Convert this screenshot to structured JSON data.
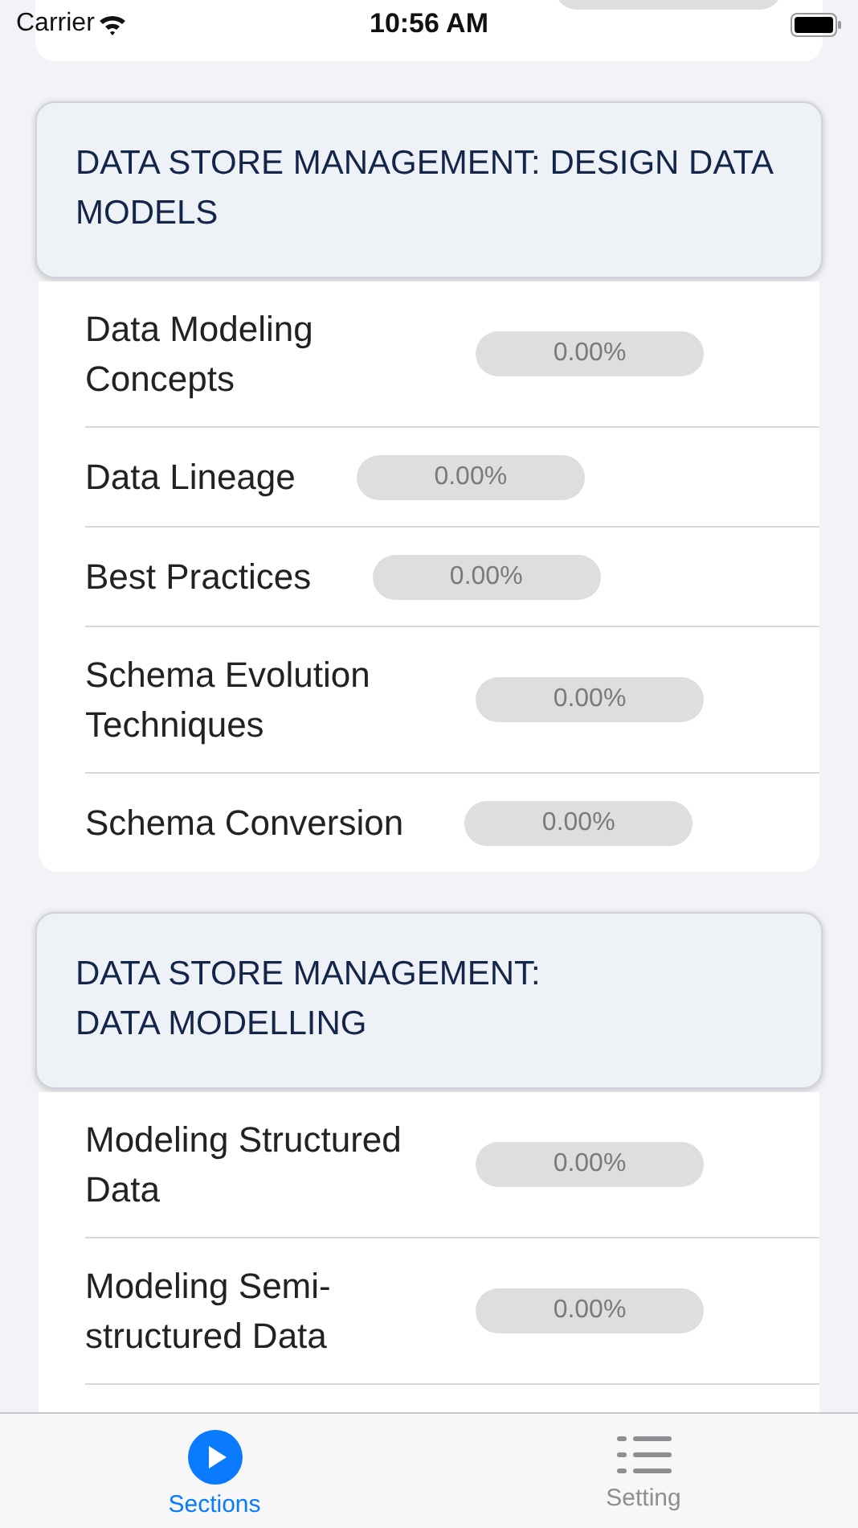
{
  "status_bar": {
    "carrier": "Carrier",
    "time": "10:56 AM"
  },
  "sections": [
    {
      "title": "DATA STORE MANAGEMENT: DESIGN DATA MODELS",
      "topics": [
        {
          "name": "Data Modeling Concepts",
          "progress": "0.00%"
        },
        {
          "name": "Data Lineage",
          "progress": "0.00%"
        },
        {
          "name": "Best Practices",
          "progress": "0.00%"
        },
        {
          "name": "Schema Evolution Techniques",
          "progress": "0.00%"
        },
        {
          "name": "Schema Conversion",
          "progress": "0.00%"
        }
      ]
    },
    {
      "title": "DATA STORE MANAGEMENT:\nDATA MODELLING",
      "topics": [
        {
          "name": "Modeling Structured Data",
          "progress": "0.00%"
        },
        {
          "name": "Modeling Semi-structured Data",
          "progress": "0.00%"
        }
      ]
    }
  ],
  "tabs": [
    {
      "label": "Sections",
      "kind": "play",
      "selected": true
    },
    {
      "label": "Setting",
      "kind": "list",
      "selected": false
    }
  ]
}
